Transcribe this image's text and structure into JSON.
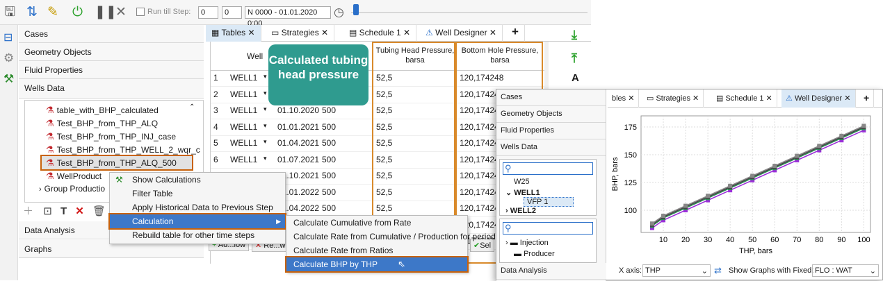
{
  "toolbar": {
    "run_till_label": "Run till Step:",
    "step_val": "0",
    "step_val2": "0",
    "date_label": "N 0000 - 01.01.2020 0:00"
  },
  "sidebar": {
    "cases": "Cases",
    "geometry": "Geometry Objects",
    "fluid": "Fluid Properties",
    "wells": "Wells Data",
    "data_analysis": "Data Analysis",
    "graphs": "Graphs",
    "tree": [
      "table_with_BHP_calculated",
      "Test_BHP_from_THP_ALQ",
      "Test_BHP_from_THP_INJ_case",
      "Test_BHP_from_THP_WELL_2_wqr_c",
      "Test_BHP_from_THP_ALQ_500",
      "WellProduct",
      "Group Productio"
    ]
  },
  "tabs": [
    "Tables",
    "Strategies",
    "Schedule 1",
    "Well Designer"
  ],
  "table": {
    "col_well": "Well",
    "col_thp": "Tubing Head Pressure, barsa",
    "col_bhp": "Bottom Hole Pressure, barsa",
    "rows": [
      [
        "1",
        "WELL1",
        "",
        "",
        "52,5",
        "120,174248"
      ],
      [
        "2",
        "WELL1",
        "",
        "",
        "52,5",
        "120,174248"
      ],
      [
        "3",
        "WELL1",
        "01.10.2020",
        "500",
        "52,5",
        "120,174248"
      ],
      [
        "4",
        "WELL1",
        "01.01.2021",
        "500",
        "52,5",
        "120,174248"
      ],
      [
        "5",
        "WELL1",
        "01.04.2021",
        "500",
        "52,5",
        "120,174248"
      ],
      [
        "6",
        "WELL1",
        "01.07.2021",
        "500",
        "52,5",
        "120,174248"
      ],
      [
        "7",
        "WELL1",
        "01.10.2021",
        "500",
        "52,5",
        "120,174248"
      ],
      [
        "",
        "",
        "01.01.2022",
        "500",
        "52,5",
        "120,174248"
      ],
      [
        "",
        "",
        "01.04.2022",
        "500",
        "52,5",
        "120,174248"
      ],
      [
        "",
        "",
        "01.07.2022",
        "500",
        "52,5",
        "120,174248"
      ],
      [
        "",
        "",
        "",
        "",
        "",
        "0,174248"
      ]
    ]
  },
  "callout": "Calculated tubing head pressure",
  "context_menu": [
    "Show Calculations",
    "Filter Table",
    "Apply Historical Data to Previous Step",
    "Calculation",
    "Rebuild table for other time steps"
  ],
  "submenu": [
    "Calculate Cumulative from Rate",
    "Calculate Rate from Cumulative / Production for period",
    "Calculate Rate from Ratios",
    "Calculate BHP by THP"
  ],
  "bottom_buttons": [
    "Ad...low",
    "Re...w",
    "Sel"
  ],
  "inset": {
    "cases": "Cases",
    "geometry": "Geometry Objects",
    "fluid": "Fluid Properties",
    "wells": "Wells Data",
    "data_analysis": "Data Analysis",
    "tree1": [
      "W25",
      "WELL1",
      "VFP 1",
      "WELL2"
    ],
    "tree2": [
      "Injection",
      "Producer"
    ],
    "tabs": [
      "bles",
      "Strategies",
      "Schedule 1",
      "Well Designer"
    ],
    "xaxis_label": "X axis:",
    "xaxis_val": "THP",
    "show_graphs": "Show Graphs with Fixed:",
    "fixed_val": "FLO : WAT"
  },
  "chart_data": {
    "type": "line",
    "xlabel": "THP, bars",
    "ylabel": "BHP, bars",
    "x": [
      5,
      10,
      20,
      30,
      40,
      50,
      60,
      70,
      80,
      90,
      100
    ],
    "xticks": [
      10,
      20,
      30,
      40,
      50,
      60,
      70,
      80,
      90,
      100
    ],
    "yticks": [
      100,
      125,
      150,
      175
    ],
    "ylim": [
      80,
      185
    ],
    "xlim": [
      0,
      103
    ],
    "series": [
      {
        "color": "#9b30d9",
        "values": [
          84,
          91,
          100,
          109,
          118,
          127,
          136,
          145,
          154,
          163,
          172
        ]
      },
      {
        "color": "#2e8b57",
        "values": [
          86,
          93,
          102,
          111,
          120,
          129,
          138,
          147,
          156,
          165,
          174
        ]
      },
      {
        "color": "#444444",
        "values": [
          87,
          94,
          103,
          112,
          121,
          130,
          139,
          148,
          157,
          166,
          175
        ]
      },
      {
        "color": "#888888",
        "values": [
          88,
          95,
          104,
          113,
          122,
          131,
          140,
          149,
          158,
          167,
          176
        ]
      }
    ]
  },
  "colors": {
    "highlight": "#c8620b",
    "accent": "#3d78c8",
    "callout": "#2f9b8f"
  }
}
